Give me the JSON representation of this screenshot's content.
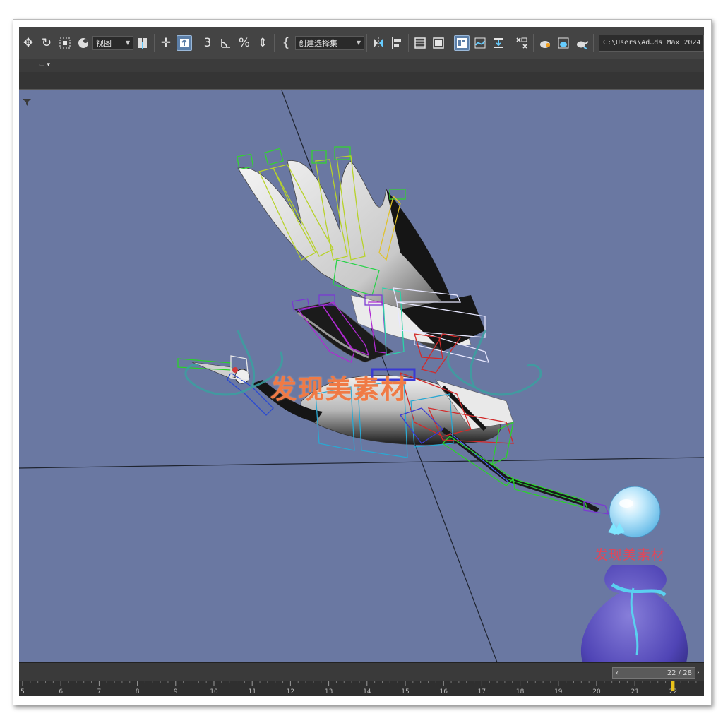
{
  "toolbar": {
    "view_dropdown": "视图",
    "selection_set_dropdown": "创建选择集",
    "snap_label": "3",
    "percent_icon": "%",
    "project_path": "C:\\Users\\Ad…ds Max 2024"
  },
  "timeline": {
    "frame_display": "22 / 28",
    "ruler_ticks": [
      "5",
      "6",
      "7",
      "8",
      "9",
      "10",
      "11",
      "12",
      "13",
      "14",
      "15",
      "16",
      "17",
      "18",
      "19",
      "20",
      "21",
      "22"
    ]
  },
  "watermark": {
    "title": "发现美素材",
    "small_title": "发现美素材"
  },
  "colors": {
    "viewport_bg": "#6a78a2",
    "toolbar_bg": "#444444",
    "watermark_orange": "#f07a45",
    "watermark_red": "#e0475a"
  },
  "icons": [
    "move-icon",
    "rotate-icon",
    "select-region-icon",
    "paint-select-icon",
    "view-dropdown",
    "pivot-icon",
    "select-move-icon",
    "select-object-icon",
    "snap-3d-icon",
    "angle-snap-icon",
    "percent-snap-icon",
    "spinner-snap-icon",
    "named-selection-icon",
    "mirror-icon",
    "align-icon",
    "scene-explorer-icon",
    "layer-explorer-icon",
    "ribbon-icon",
    "curve-editor-icon",
    "schematic-icon",
    "render-setup-icon",
    "rendered-frame-icon",
    "render-icon",
    "teapot-icon"
  ]
}
